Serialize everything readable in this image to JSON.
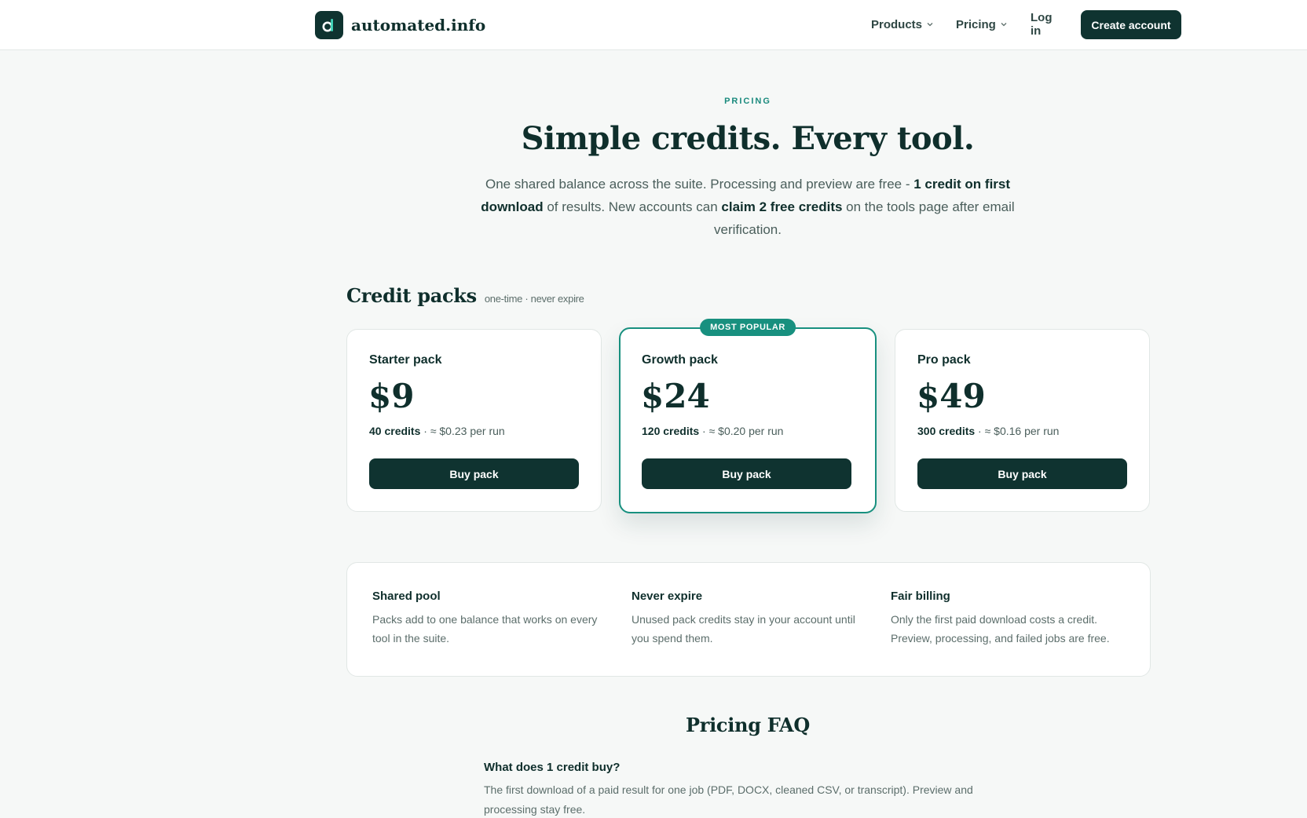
{
  "header": {
    "brand": "automated.info",
    "nav": {
      "products": "Products",
      "pricing": "Pricing",
      "login": "Log in",
      "create_account": "Create account"
    }
  },
  "hero": {
    "eyebrow": "PRICING",
    "title": "Simple credits. Every tool.",
    "subtitle_part1": "One shared balance across the suite. Processing and preview are free - ",
    "subtitle_bold1": "1 credit on first download",
    "subtitle_part2": " of results. New accounts can ",
    "subtitle_bold2": "claim 2 free credits",
    "subtitle_part3": " on the tools page after email verification."
  },
  "packs": {
    "title": "Credit packs",
    "note": "one-time · never expire",
    "items": [
      {
        "name": "Starter pack",
        "price": "$9",
        "credits": "40 credits",
        "per_run": " · ≈ $0.23 per run",
        "button": "Buy pack"
      },
      {
        "name": "Growth pack",
        "price": "$24",
        "credits": "120 credits",
        "per_run": " · ≈ $0.20 per run",
        "button": "Buy pack",
        "badge": "MOST POPULAR"
      },
      {
        "name": "Pro pack",
        "price": "$49",
        "credits": "300 credits",
        "per_run": " · ≈ $0.16 per run",
        "button": "Buy pack"
      }
    ]
  },
  "features": [
    {
      "title": "Shared pool",
      "text": "Packs add to one balance that works on every tool in the suite."
    },
    {
      "title": "Never expire",
      "text": "Unused pack credits stay in your account until you spend them."
    },
    {
      "title": "Fair billing",
      "text": "Only the first paid download costs a credit. Preview, processing, and failed jobs are free."
    }
  ],
  "faq": {
    "title": "Pricing FAQ",
    "items": [
      {
        "q": "What does 1 credit buy?",
        "a": "The first download of a paid result for one job (PDF, DOCX, cleaned CSV, or transcript). Preview and processing stay free."
      }
    ]
  },
  "colors": {
    "primary": "#0f3330",
    "accent": "#18907f",
    "background": "#f6f8f7"
  }
}
